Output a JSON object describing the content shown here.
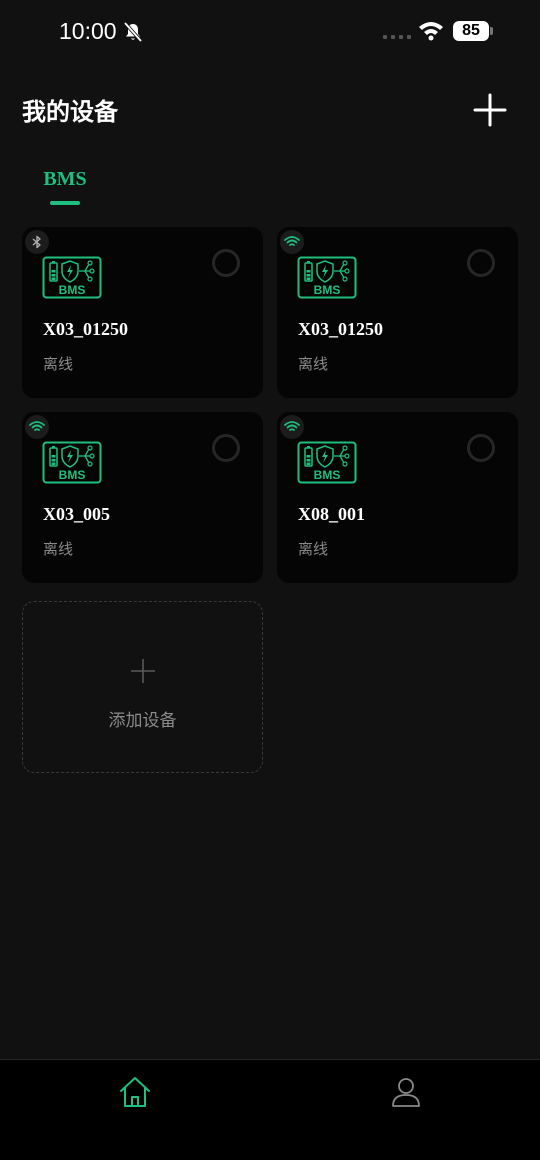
{
  "status_bar": {
    "time": "10:00",
    "battery": "85"
  },
  "header": {
    "title": "我的设备"
  },
  "tabs": [
    {
      "label": "BMS",
      "active": true
    }
  ],
  "devices": [
    {
      "name": "X03_01250",
      "status": "离线",
      "connection": "bluetooth-icon"
    },
    {
      "name": "X03_01250",
      "status": "离线",
      "connection": "wifi-icon"
    },
    {
      "name": "X03_005",
      "status": "离线",
      "connection": "wifi-icon"
    },
    {
      "name": "X08_001",
      "status": "离线",
      "connection": "wifi-icon"
    }
  ],
  "device_icon_text": "BMS",
  "add_device": {
    "label": "添加设备"
  },
  "bottom_nav": [
    {
      "icon": "home-icon",
      "active": true
    },
    {
      "icon": "profile-icon",
      "active": false
    }
  ],
  "colors": {
    "accent": "#1fc07f",
    "background": "#111111",
    "card": "#050505",
    "muted_text": "#8a8a8a"
  }
}
